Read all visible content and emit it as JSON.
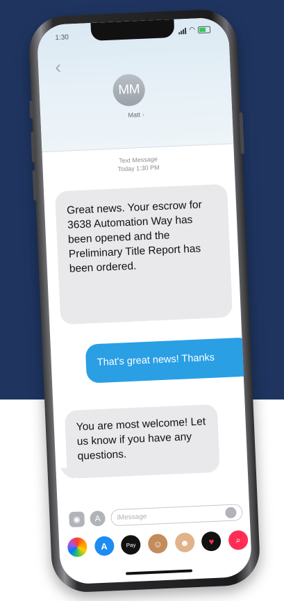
{
  "status_bar": {
    "time": "1:30",
    "wifi_icon": "wifi-icon",
    "battery_color": "#34c759"
  },
  "contact": {
    "initials": "MM",
    "name": "Matt",
    "chevron": "›"
  },
  "thread_meta": {
    "service": "Text Message",
    "timestamp": "Today 1:30 PM"
  },
  "messages": [
    {
      "direction": "incoming",
      "text": "Great news. Your escrow for 3638 Automation Way has been opened and the Preliminary Title Report has been ordered."
    },
    {
      "direction": "outgoing",
      "text": "That's great news! Thanks"
    },
    {
      "direction": "incoming",
      "text": "You are most welcome! Let us know if you have any questions."
    }
  ],
  "composer": {
    "placeholder": "iMessage",
    "camera_icon": "camera-icon",
    "apps_icon": "app-store-icon"
  },
  "app_drawer": [
    {
      "name": "photos-icon",
      "glyph": ""
    },
    {
      "name": "app-store-icon",
      "glyph": "A"
    },
    {
      "name": "apple-pay-icon",
      "glyph": "Pay"
    },
    {
      "name": "memoji-icon",
      "glyph": "☺"
    },
    {
      "name": "memoji-stickers-icon",
      "glyph": "☻"
    },
    {
      "name": "digital-touch-icon",
      "glyph": "♥"
    },
    {
      "name": "image-search-icon",
      "glyph": "⌕"
    }
  ],
  "colors": {
    "background_top": "#1f3560",
    "bubble_outgoing": "#2a9fe4",
    "bubble_incoming": "#e9e9eb"
  }
}
